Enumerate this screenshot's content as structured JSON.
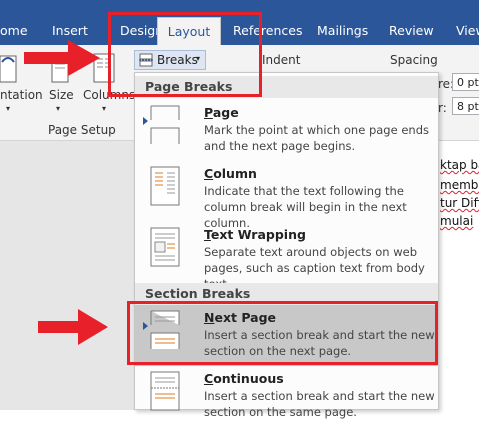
{
  "tabs": [
    "ome",
    "Insert",
    "Design",
    "Layout",
    "References",
    "Mailings",
    "Review",
    "View"
  ],
  "ribbon": {
    "orientation_label": "ntation",
    "size_label": "Size",
    "columns_label": "Columns",
    "page_setup_label": "Page Setup",
    "breaks_label": "Breaks",
    "indent_label": "Indent",
    "spacing_label": "Spacing",
    "before_label": "re:",
    "after_label": "r:",
    "before_value": "0 pt",
    "after_value": "8 pt"
  },
  "document_fragments": [
    "ktap ba",
    "membu",
    "tur Diff",
    "mulai"
  ],
  "menu": {
    "page_breaks_header": "Page Breaks",
    "section_breaks_header": "Section Breaks",
    "items": [
      {
        "mnemonic": "P",
        "title": "age",
        "desc": "Mark the point at which one page ends and the next page begins."
      },
      {
        "mnemonic": "C",
        "title": "olumn",
        "desc": "Indicate that the text following the column break will begin in the next column."
      },
      {
        "mnemonic": "T",
        "title": "ext Wrapping",
        "desc": "Separate text around objects on web pages, such as caption text from body text."
      },
      {
        "mnemonic": "N",
        "title": "ext Page",
        "desc": "Insert a section break and start the new section on the next page."
      },
      {
        "mnemonic": "C",
        "title": "ontinuous",
        "desc": "Insert a section break and start the new section on the same page."
      }
    ]
  },
  "colors": {
    "ribbon_blue": "#2b579a",
    "annotation_red": "#e8202a",
    "highlight": "#c8c8c8"
  }
}
